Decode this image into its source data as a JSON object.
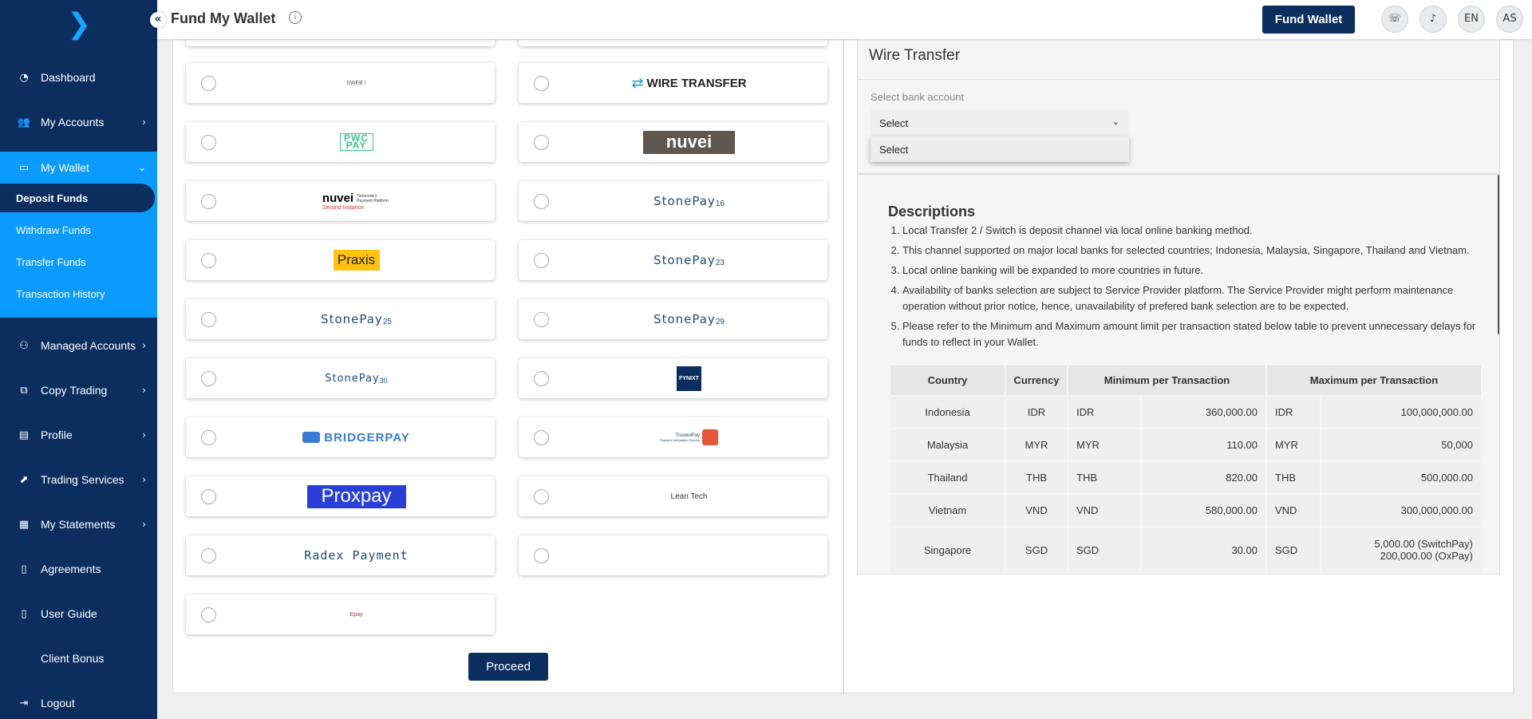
{
  "header": {
    "title": "Fund My Wallet",
    "info": "i",
    "fund_button": "Fund Wallet",
    "lang": "EN",
    "user_initials": "AS"
  },
  "sidebar": {
    "items": [
      {
        "label": "Dashboard"
      },
      {
        "label": "My Accounts"
      },
      {
        "label": "My Wallet"
      },
      {
        "label": "Managed Accounts"
      },
      {
        "label": "Copy Trading"
      },
      {
        "label": "Profile"
      },
      {
        "label": "Trading Services"
      },
      {
        "label": "My Statements"
      },
      {
        "label": "Agreements"
      },
      {
        "label": "User Guide"
      },
      {
        "label": "Client Bonus"
      },
      {
        "label": "Logout"
      }
    ],
    "wallet_sub": [
      {
        "label": "Deposit Funds"
      },
      {
        "label": "Withdraw Funds"
      },
      {
        "label": "Transfer Funds"
      },
      {
        "label": "Transaction History"
      }
    ]
  },
  "methods": [
    {
      "name": "SWEB !"
    },
    {
      "name": "WIRE TRANSFER"
    },
    {
      "name": "PWC PAY"
    },
    {
      "name": "nuvei"
    },
    {
      "name": "nuvei",
      "sub": "Tomorrow's Payment Platform",
      "note": "Second Instance"
    },
    {
      "name": "StonePay",
      "suffix": "16"
    },
    {
      "name": "Praxis"
    },
    {
      "name": "StonePay",
      "suffix": "23"
    },
    {
      "name": "StonePay",
      "suffix": "25"
    },
    {
      "name": "StonePay",
      "suffix": "29"
    },
    {
      "name": "StonePay",
      "suffix": "30"
    },
    {
      "name": "FYNIXT"
    },
    {
      "name": "BRIDGERPAY"
    },
    {
      "name": "TrustedPay",
      "sub": "Payment Integration Service"
    },
    {
      "name": "Proxpay"
    },
    {
      "name": "Lean Tech"
    },
    {
      "name": "Radex Payment"
    },
    {
      "name": ""
    },
    {
      "name": "Epay"
    }
  ],
  "proceed": "Proceed",
  "wire_transfer": {
    "title": "Wire Transfer",
    "select_label": "Select bank account",
    "selected": "Select",
    "options": [
      "Select"
    ]
  },
  "descriptions": {
    "title": "Descriptions",
    "items": [
      "Local Transfer 2 / Switch is deposit channel via local online banking method.",
      "This channel supported on major local banks for selected countries; Indonesia, Malaysia, Singapore, Thailand and Vietnam.",
      "Local online banking will be expanded to more countries in future.",
      "Availability of banks selection are subject to Service Provider platform. The Service Provider might perform maintenance operation without prior notice, hence, unavailability of prefered bank selection are to be expected.",
      "Please refer to the Minimum and Maximum amount limit per transaction stated below table to prevent unnecessary delays for funds to reflect in your Wallet."
    ],
    "table": {
      "headers": [
        "Country",
        "Currency",
        "Minimum per Transaction",
        "Maximum per Transaction"
      ],
      "rows": [
        {
          "country": "Indonesia",
          "currency": "IDR",
          "min_cur": "IDR",
          "min": "360,000.00",
          "max_cur": "IDR",
          "max": "100,000,000.00"
        },
        {
          "country": "Malaysia",
          "currency": "MYR",
          "min_cur": "MYR",
          "min": "110.00",
          "max_cur": "MYR",
          "max": "50,000"
        },
        {
          "country": "Thailand",
          "currency": "THB",
          "min_cur": "THB",
          "min": "820.00",
          "max_cur": "THB",
          "max": "500,000.00"
        },
        {
          "country": "Vietnam",
          "currency": "VND",
          "min_cur": "VND",
          "min": "580,000.00",
          "max_cur": "VND",
          "max": "300,000,000.00"
        },
        {
          "country": "Singapore",
          "currency": "SGD",
          "min_cur": "SGD",
          "min": "30.00",
          "max_cur": "SGD",
          "max": "5,000.00 (SwitchPay)",
          "max2": "200,000.00 (OxPay)"
        }
      ]
    }
  }
}
